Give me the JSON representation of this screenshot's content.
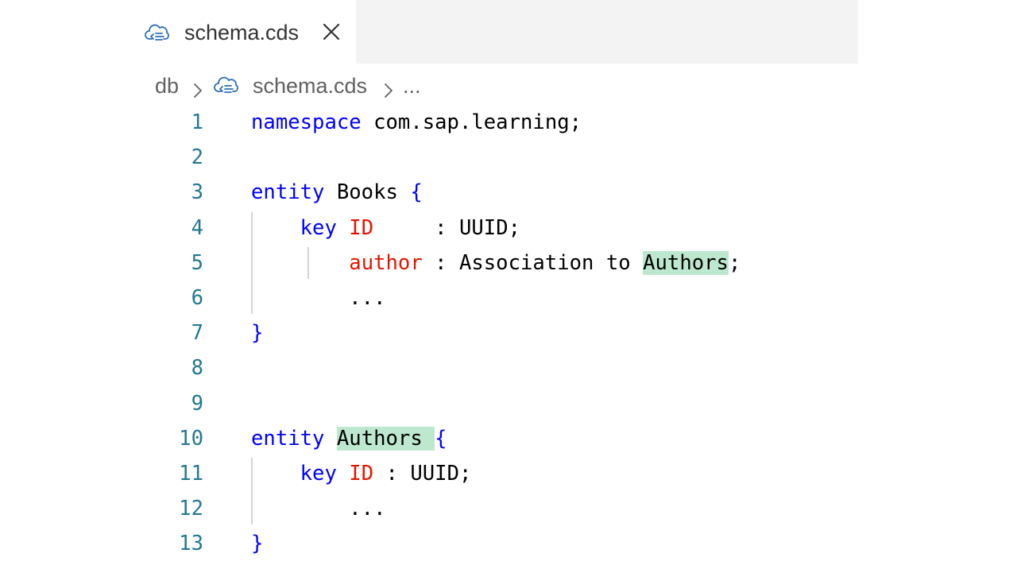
{
  "tab": {
    "file_name": "schema.cds",
    "icon": "sap-cds-cloud-icon",
    "close_glyph": "✕"
  },
  "breadcrumb": {
    "folder": "db",
    "file": "schema.cds",
    "more": "..."
  },
  "colors": {
    "keyword": "#0000ff",
    "identifier": "#e51400",
    "line_number": "#237893",
    "highlight": "#bde8cf",
    "tabbar_background": "#f3f3f3"
  },
  "code": {
    "lines": [
      {
        "num": "1",
        "tokens": [
          {
            "t": "namespace",
            "c": "kw"
          },
          {
            "t": " com.sap.learning;",
            "c": "pl"
          }
        ]
      },
      {
        "num": "2",
        "tokens": []
      },
      {
        "num": "3",
        "tokens": [
          {
            "t": "entity",
            "c": "kw"
          },
          {
            "t": " Books ",
            "c": "pl"
          },
          {
            "t": "{",
            "c": "kw"
          }
        ]
      },
      {
        "num": "4",
        "tokens": [
          {
            "t": "    ",
            "c": "pl"
          },
          {
            "t": "key",
            "c": "kw"
          },
          {
            "t": " ",
            "c": "pl"
          },
          {
            "t": "ID",
            "c": "var"
          },
          {
            "t": "     : UUID;",
            "c": "pl"
          }
        ]
      },
      {
        "num": "5",
        "tokens": [
          {
            "t": "        ",
            "c": "pl"
          },
          {
            "t": "author",
            "c": "var"
          },
          {
            "t": " : Association to ",
            "c": "pl"
          },
          {
            "t": "Authors",
            "c": "pl hl"
          },
          {
            "t": ";",
            "c": "pl"
          }
        ]
      },
      {
        "num": "6",
        "tokens": [
          {
            "t": "        ...",
            "c": "pl"
          }
        ]
      },
      {
        "num": "7",
        "tokens": [
          {
            "t": "}",
            "c": "kw"
          }
        ]
      },
      {
        "num": "8",
        "tokens": []
      },
      {
        "num": "9",
        "tokens": []
      },
      {
        "num": "10",
        "tokens": [
          {
            "t": "entity",
            "c": "kw"
          },
          {
            "t": " ",
            "c": "pl"
          },
          {
            "t": "Authors ",
            "c": "pl hl"
          },
          {
            "t": "{",
            "c": "kw"
          }
        ]
      },
      {
        "num": "11",
        "tokens": [
          {
            "t": "    ",
            "c": "pl"
          },
          {
            "t": "key",
            "c": "kw"
          },
          {
            "t": " ",
            "c": "pl"
          },
          {
            "t": "ID",
            "c": "var"
          },
          {
            "t": " : UUID;",
            "c": "pl"
          }
        ]
      },
      {
        "num": "12",
        "tokens": [
          {
            "t": "        ...",
            "c": "pl"
          }
        ]
      },
      {
        "num": "13",
        "tokens": [
          {
            "t": "}",
            "c": "kw"
          }
        ]
      }
    ]
  }
}
